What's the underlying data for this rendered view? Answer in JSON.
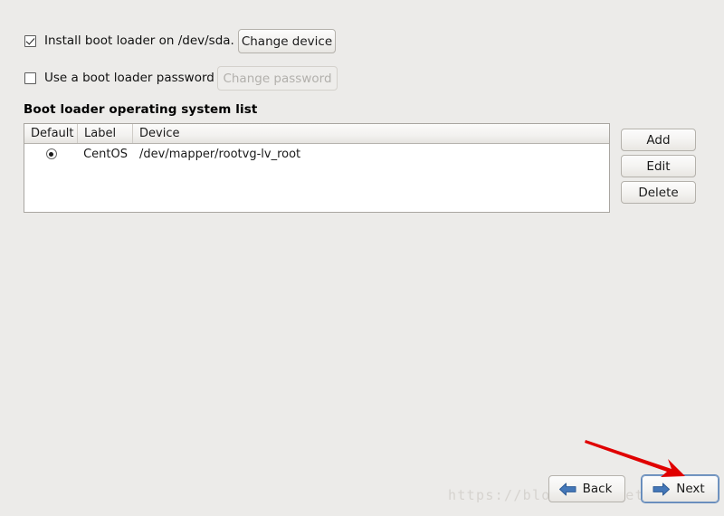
{
  "options": {
    "bootloader": {
      "label": "Install boot loader on /dev/sda.",
      "checked": true,
      "button_label": "Change device"
    },
    "password": {
      "label": "Use a boot loader password",
      "checked": false,
      "button_label": "Change password",
      "button_disabled": true
    }
  },
  "os_list": {
    "heading": "Boot loader operating system list",
    "columns": [
      "Default",
      "Label",
      "Device"
    ],
    "rows": [
      {
        "default": true,
        "label": "CentOS",
        "device": "/dev/mapper/rootvg-lv_root"
      }
    ]
  },
  "side_actions": {
    "add": "Add",
    "edit": "Edit",
    "delete": "Delete"
  },
  "navigation": {
    "back": "Back",
    "next": "Next",
    "arrow_color": "#3f6fad"
  },
  "annotation": {
    "arrow_color": "#e00000"
  },
  "watermark": {
    "text": "https://blog.csdn.net/akangwu"
  },
  "colors": {
    "page_background": "#ecebe9",
    "table_background": "#ffffff",
    "border": "#a9a6a1",
    "focus_ring": "#5f86b8"
  }
}
